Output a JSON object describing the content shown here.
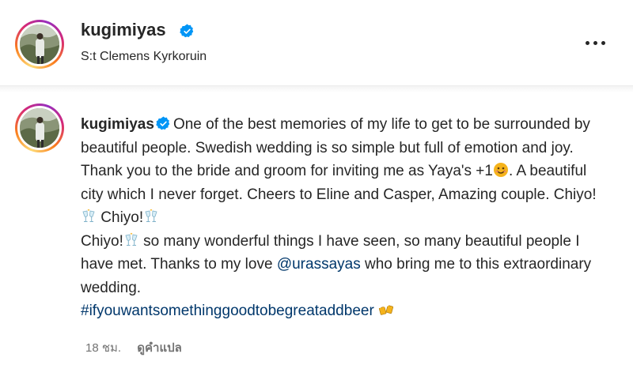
{
  "header": {
    "username": "kugimiyas",
    "location": "S:t Clemens Kyrkoruin",
    "more_icon": "more-horizontal-icon"
  },
  "caption": {
    "username": "kugimiyas",
    "text_1": "One of the best memories of my life to get to be surrounded by beautiful people. Swedish wedding is so simple but full of emotion and joy. Thank you to the bride and groom for inviting me as Yaya's +1",
    "text_2": ". A beautiful city which I never forget. Cheers to Eline and Casper, Amazing couple. Chiyo!",
    "text_3": " Chiyo!",
    "text_4": "Chiyo!",
    "text_5": " so many wonderful things I have seen, so many beautiful people I have met. Thanks to my love ",
    "mention": "@urassayas",
    "text_6": " who bring me to this extraordinary wedding.",
    "hashtag": "#ifyouwantsomethinggoodtobegreataddbeer"
  },
  "footer": {
    "time": "18 ชม.",
    "translate": "ดูคำแปล"
  },
  "icons": {
    "verified": "verified-badge-icon",
    "smile_emoji": "smiling-face-emoji",
    "cheers_emoji": "clinking-glasses-emoji",
    "beer_emoji": "clinking-beer-mugs-emoji"
  },
  "colors": {
    "verified": "#0095f6",
    "link": "#00376b",
    "secondary_text": "#737373"
  }
}
